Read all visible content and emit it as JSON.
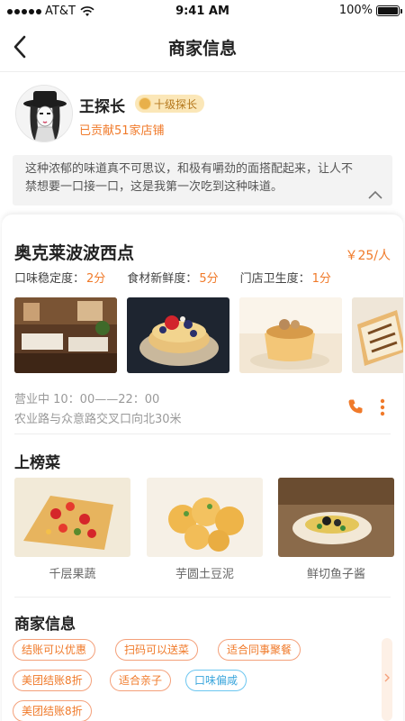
{
  "status_bar": {
    "carrier": "AT&T",
    "time": "9:41 AM",
    "battery": "100%",
    "battery_level": 1.0
  },
  "nav": {
    "title": "商家信息",
    "back_icon": "chevron-left-icon"
  },
  "profile": {
    "name": "王探长",
    "badge": "十级探长",
    "contribution": "已贡献51家店铺",
    "quote": "这种浓郁的味道真不可思议，和极有嚼劲的面搭配起来，让人不禁想要一口接一口，这是我第一次吃到这种味道。"
  },
  "shop": {
    "name": "奥克莱波波西点",
    "price": "￥25/人",
    "ratings": [
      {
        "label": "口味稳定度：",
        "score": "2分"
      },
      {
        "label": "食材新鲜度：",
        "score": "5分"
      },
      {
        "label": "门店卫生度：",
        "score": "1分"
      }
    ],
    "photos": [
      "restaurant-interior",
      "berry-pancakes",
      "pudding-dessert",
      "toast-sandwich"
    ],
    "hours": "营业中  10：00——22：00",
    "address": "农业路与众意路交叉口向北30米"
  },
  "top_dishes": {
    "title": "上榜菜",
    "items": [
      {
        "name": "千层果蔬"
      },
      {
        "name": "芋圆土豆泥"
      },
      {
        "name": "鲜切鱼子酱"
      }
    ]
  },
  "merchant_info": {
    "title": "商家信息",
    "tags": [
      "结账可以优惠",
      "扫码可以送菜",
      "适合同事聚餐",
      "美团结账8折",
      "适合亲子",
      "口味偏咸",
      "美团结账8折"
    ]
  },
  "colors": {
    "accent": "#f07a2a",
    "blue_tag": "#3ba6dc",
    "badge_bg": "#fbe7b8"
  }
}
